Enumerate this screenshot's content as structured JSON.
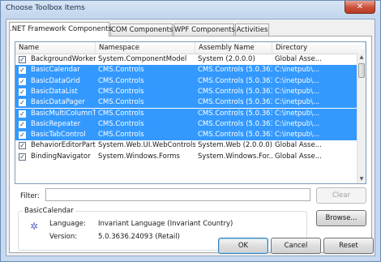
{
  "window": {
    "title": "Choose Toolbox Items",
    "close_glyph": "✕"
  },
  "tabs": [
    {
      "label": ".NET Framework Components",
      "active": true
    },
    {
      "label": "COM Components",
      "active": false
    },
    {
      "label": "WPF Components",
      "active": false
    },
    {
      "label": "Activities",
      "active": false
    }
  ],
  "grid": {
    "columns": [
      "Name",
      "Namespace",
      "Assembly Name",
      "Directory"
    ],
    "rows": [
      {
        "checked": true,
        "selected": false,
        "name": "BackgroundWorker",
        "namespace": "System.ComponentModel",
        "assembly": "System (2.0.0.0)",
        "directory": "Global Asse..."
      },
      {
        "checked": true,
        "selected": true,
        "name": "BasicCalendar",
        "namespace": "CMS.Controls",
        "assembly": "CMS.Controls (5.0.363...",
        "directory": "C:\\inetpub\\..."
      },
      {
        "checked": true,
        "selected": true,
        "name": "BasicDataGrid",
        "namespace": "CMS.Controls",
        "assembly": "CMS.Controls (5.0.363...",
        "directory": "C:\\inetpub\\..."
      },
      {
        "checked": true,
        "selected": true,
        "name": "BasicDataList",
        "namespace": "CMS.Controls",
        "assembly": "CMS.Controls (5.0.363...",
        "directory": "C:\\inetpub\\..."
      },
      {
        "checked": true,
        "selected": true,
        "name": "BasicDataPager",
        "namespace": "CMS.Controls",
        "assembly": "CMS.Controls (5.0.363...",
        "directory": "C:\\inetpub\\..."
      },
      {
        "checked": true,
        "selected": true,
        "name": "BasicMultiColumnTa...",
        "namespace": "CMS.Controls",
        "assembly": "CMS.Controls (5.0.363...",
        "directory": "C:\\inetpub\\..."
      },
      {
        "checked": true,
        "selected": true,
        "name": "BasicRepeater",
        "namespace": "CMS.Controls",
        "assembly": "CMS.Controls (5.0.363...",
        "directory": "C:\\inetpub\\..."
      },
      {
        "checked": true,
        "selected": true,
        "name": "BasicTabControl",
        "namespace": "CMS.Controls",
        "assembly": "CMS.Controls (5.0.363...",
        "directory": "C:\\inetpub\\..."
      },
      {
        "checked": true,
        "selected": false,
        "name": "BehaviorEditorPart",
        "namespace": "System.Web.UI.WebControls...",
        "assembly": "System.Web (2.0.0.0)",
        "directory": "Global Asse..."
      },
      {
        "checked": true,
        "selected": false,
        "name": "BindingNavigator",
        "namespace": "System.Windows.Forms",
        "assembly": "System.Windows.For...",
        "directory": "Global Asse..."
      }
    ],
    "check_glyph": "✓"
  },
  "filter": {
    "label": "Filter:",
    "value": "",
    "clear_label": "Clear"
  },
  "details": {
    "group_title": "BasicCalendar",
    "icon": "gear-icon",
    "language_label": "Language:",
    "language_value": "Invariant Language (Invariant Country)",
    "version_label": "Version:",
    "version_value": "5.0.3636.24093 (Retail)",
    "browse_label": "Browse..."
  },
  "footer": {
    "ok_label": "OK",
    "cancel_label": "Cancel",
    "reset_label": "Reset"
  },
  "colors": {
    "selection": "#3399ff",
    "titlebar": "#c6d9ee",
    "close_button": "#c9503a"
  }
}
